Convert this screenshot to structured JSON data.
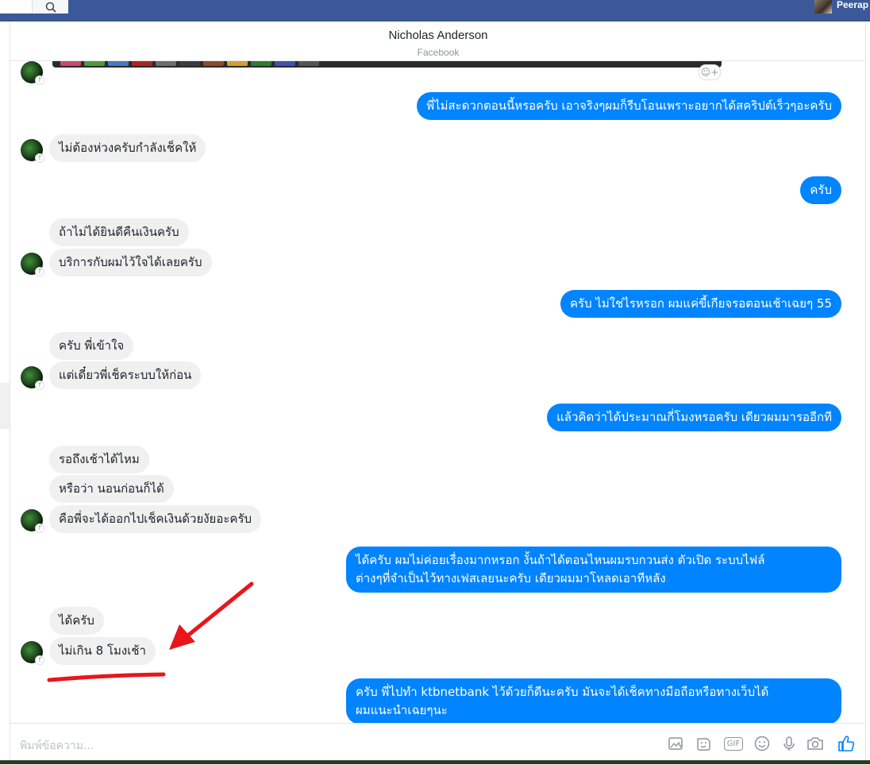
{
  "topbar": {
    "user_name": "Peerap"
  },
  "chat": {
    "contact_name": "Nicholas Anderson",
    "subtitle": "Facebook"
  },
  "messages": [
    {
      "side": "me",
      "text": "พี่ไม่สะดวกตอนนี้หรอครับ เอาจริงๆผมก็รีบโอนเพราะอยากได้สคริปต์เร็วๆอะครับ"
    },
    {
      "side": "them",
      "text": "ไม่ต้องห่วงครับกำลังเช็คให้"
    },
    {
      "side": "me",
      "text": "ครับ"
    },
    {
      "side": "them",
      "text": "ถ้าไม่ได้ยินดีคืนเงินครับ"
    },
    {
      "side": "them",
      "text": "บริการกับผมไว้ใจได้เลยครับ"
    },
    {
      "side": "me",
      "text": "ครับ ไม่ใช่ไรหรอก ผมแค่ขี้เกียจรอตอนเช้าเฉยๆ 55"
    },
    {
      "side": "them",
      "text": "ครับ พี่เข้าใจ"
    },
    {
      "side": "them",
      "text": "แต่เดี๋ยวพี่เช็คระบบให้ก่อน"
    },
    {
      "side": "me",
      "text": "แล้วคิดว่าได้ประมาณกี่โมงหรอครับ เดียวผมมารออีกที"
    },
    {
      "side": "them",
      "text": "รอถึงเช้าได้ไหม"
    },
    {
      "side": "them",
      "text": "หรือว่า นอนก่อนก็ได้"
    },
    {
      "side": "them",
      "text": "คือพี่จะได้ออกไปเช็คเงินด้วยงัยอะครับ"
    },
    {
      "side": "me",
      "line1": "ได้ครับ ผมไม่ค่อยเรื่องมากหรอก งั้นถ้าได้ตอนไหนผมรบกวนส่ง ตัวเปิด ระบบไฟล์",
      "line2": "ต่างๆที่จำเป็นไว้ทางเฟสเลยนะครับ เดียวผมมาโหลดเอาทีหลัง"
    },
    {
      "side": "them",
      "text": "ได้ครับ"
    },
    {
      "side": "them",
      "text": "ไม่เกิน 8 โมงเช้า"
    },
    {
      "side": "me",
      "line1": "ครับ พี่ไปทำ ktbnetbank ไว้ด้วยก็ดีนะครับ มันจะได้เช็คทางมือถือหรือทางเว็บได้",
      "line2": "ผมแนะนำเฉยๆนะ"
    }
  ],
  "composer": {
    "placeholder": "พิมพ์ข้อความ...",
    "icons": [
      "image-icon",
      "sticker-icon",
      "gif-icon",
      "emoji-icon",
      "microphone-icon",
      "camera-icon",
      "like-icon"
    ],
    "gif_label": "GIF"
  },
  "colors": {
    "topbar": "#3b5998",
    "sent_bubble": "#0084ff",
    "received_bubble": "#f1f0f0",
    "annotation": "#e8161b"
  }
}
